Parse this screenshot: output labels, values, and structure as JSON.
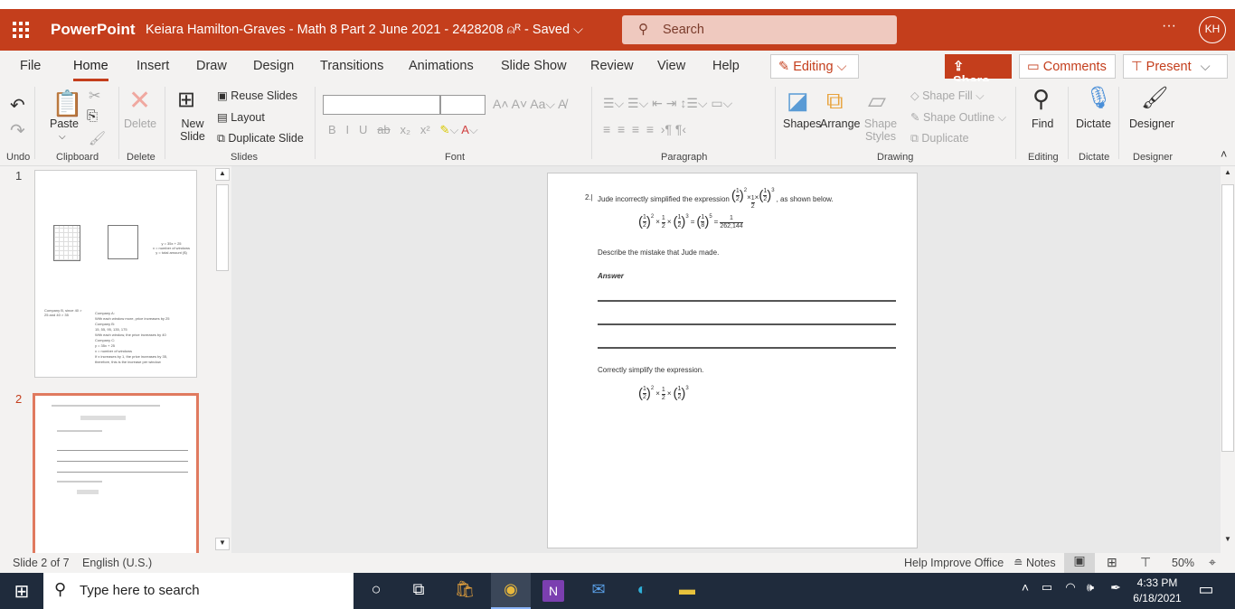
{
  "titlebar": {
    "app": "PowerPoint",
    "document": "Keiara Hamilton-Graves - Math 8 Part 2 June 2021 - 2428208 ⍝ᴿ - Saved  ⌵",
    "search_placeholder": "Search",
    "more": "···",
    "avatar": "KH"
  },
  "tabs": [
    "File",
    "Home",
    "Insert",
    "Draw",
    "Design",
    "Transitions",
    "Animations",
    "Slide Show",
    "Review",
    "View",
    "Help"
  ],
  "active_tab": "Home",
  "mode_button": "Editing ⌵",
  "share": "Share",
  "comments": "Comments",
  "present": "Present",
  "ribbon": {
    "undo_group": "Undo",
    "paste": "Paste",
    "clipboard_group": "Clipboard",
    "delete": "Delete",
    "delete_group": "Delete",
    "new_slide": "New Slide",
    "reuse": "Reuse Slides",
    "layout": "Layout",
    "duplicate_slide": "Duplicate Slide",
    "slides_group": "Slides",
    "font_group": "Font",
    "paragraph_group": "Paragraph",
    "shapes": "Shapes",
    "arrange": "Arrange",
    "shape_styles": "Shape Styles",
    "shape_fill": "Shape Fill",
    "shape_outline": "Shape Outline",
    "duplicate": "Duplicate",
    "drawing_group": "Drawing",
    "find": "Find",
    "editing_group": "Editing",
    "dictate": "Dictate",
    "dictate_group": "Dictate",
    "designer": "Designer",
    "designer_group": "Designer"
  },
  "thumbnails": [
    {
      "number": "1",
      "lines": [
        "Company B, since 40 >",
        "25 and 40 > 35",
        "Company A:",
        "With each window more, price increases by 25",
        "Company B:",
        "15, 55, 95, 135, 175",
        "With each window, the price increases by 40",
        "Company C:",
        "y = 35x + 25",
        "x = number of windows",
        "If x increases by 1, the price increases by 35,",
        "therefore, this is the increase per window"
      ],
      "graph_labels": [
        "y = 35x + 25",
        "x = number of windows",
        "y = total amount ($)"
      ]
    },
    {
      "number": "2"
    }
  ],
  "slide": {
    "question_number": "2.|",
    "intro": "Jude incorrectly simplified the expression",
    "intro_end": ", as shown below.",
    "expr": [
      {
        "n": "1",
        "d": "2",
        "e": "2"
      },
      {
        "op": "×"
      },
      {
        "n": "1",
        "d": "2"
      },
      {
        "op": "×"
      },
      {
        "n": "1",
        "d": "2",
        "e": "3"
      }
    ],
    "jude_work": [
      {
        "n": "1",
        "d": "2",
        "e": "2"
      },
      {
        "op": "×"
      },
      {
        "n": "1",
        "d": "2"
      },
      {
        "op": "×"
      },
      {
        "n": "1",
        "d": "2",
        "e": "3"
      },
      {
        "op": "="
      },
      {
        "n": "1",
        "d": "8",
        "e": "5"
      },
      {
        "op": "="
      },
      {
        "n": "1",
        "d": "262,144"
      }
    ],
    "describe": "Describe the mistake that Jude made.",
    "answer": "Answer",
    "simplify": "Correctly simplify the expression."
  },
  "status": {
    "slide": "Slide 2 of 7",
    "language": "English (U.S.)",
    "help": "Help Improve Office",
    "notes": "Notes",
    "zoom": "50%"
  },
  "taskbar": {
    "search": "Type here to search",
    "time": "4:33 PM",
    "date": "6/18/2021"
  },
  "colors": {
    "brand": "#c43e1c",
    "taskbar": "#1f2b3c"
  }
}
